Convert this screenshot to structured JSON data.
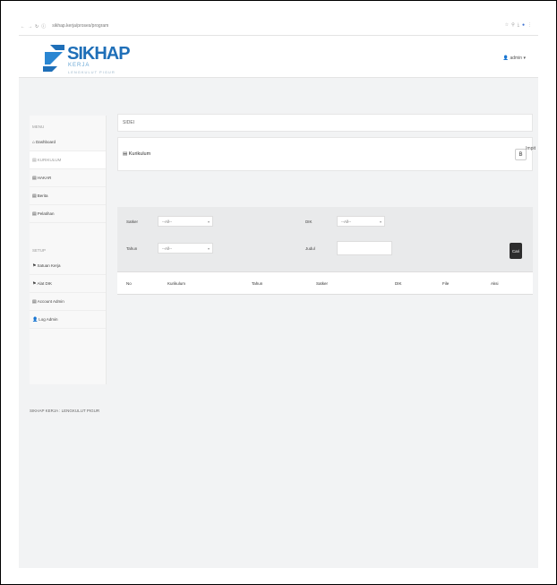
{
  "browser": {
    "url": "sikhap.kerja/proses/program",
    "nav_icons": [
      "back-icon",
      "forward-icon",
      "reload-icon",
      "info-icon"
    ]
  },
  "header": {
    "logo_text": "SIKHAP",
    "logo_sub1": "KERJA",
    "logo_sub2": "LENGKULUT PIGUR",
    "admin_label": "admin"
  },
  "sidebar": {
    "menu_heading": "MENU",
    "items": [
      {
        "icon": "home-icon",
        "label": "Dashboard"
      },
      {
        "icon": "list-icon",
        "label": "KURIKULUM"
      },
      {
        "icon": "list-icon",
        "label": "HAKAR"
      },
      {
        "icon": "list-icon",
        "label": "Berita"
      },
      {
        "icon": "list-icon",
        "label": "Pelatihan"
      }
    ],
    "setup_heading": "SETUP",
    "setup_items": [
      {
        "icon": "flag-icon",
        "label": "Satuan Kerja"
      },
      {
        "icon": "flag-icon",
        "label": "Alat DIK"
      },
      {
        "icon": "list-icon",
        "label": "Account Admin"
      },
      {
        "icon": "user-icon",
        "label": "Log Admin"
      }
    ],
    "footer": "SIKHAP KERJA : LENGKULUT PIGUR"
  },
  "main": {
    "breadcrumb": "SIDEI",
    "panel_title": "Kurikulum",
    "panel_button": "B",
    "import_label": "Impit",
    "filters": {
      "satker_label": "Satker",
      "satker_value": "--All--",
      "dik_label": "DIK",
      "dik_value": "--All--",
      "tahun_label": "Tahun",
      "tahun_value": "--All--",
      "judul_label": "Judul",
      "judul_value": "",
      "search_button": "Cari"
    },
    "table_headers": [
      "No",
      "Kurikulum",
      "Tahun",
      "Satker",
      "DIK",
      "File",
      "Aksi"
    ]
  }
}
